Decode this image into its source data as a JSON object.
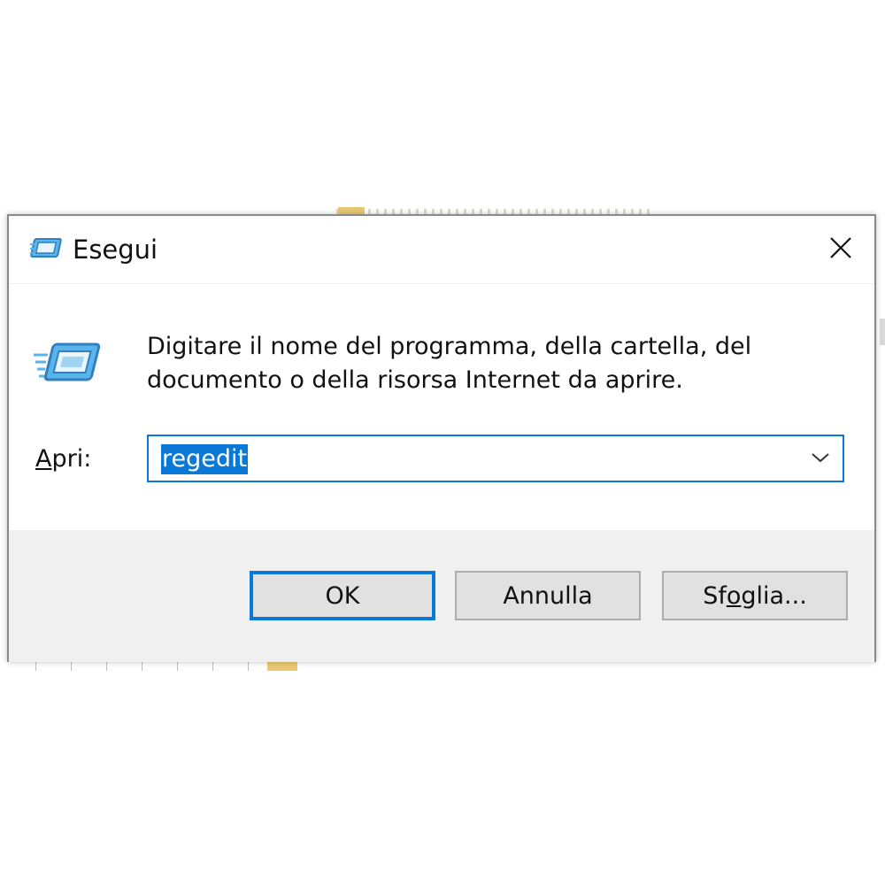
{
  "dialog": {
    "title": "Esegui",
    "title_icon": "run-icon",
    "close_icon": "close-icon",
    "description": "Digitare il nome del programma, della cartella, del documento o della risorsa Internet da aprire.",
    "open_label_accel": "A",
    "open_label_rest": "pri:",
    "open_value": "regedit",
    "dropdown_icon": "chevron-down-icon",
    "buttons": {
      "ok": "OK",
      "cancel": "Annulla",
      "browse_pre": "Sf",
      "browse_accel": "o",
      "browse_post": "glia..."
    }
  },
  "colors": {
    "accent": "#0a78d7",
    "footer_bg": "#f0f0f0",
    "button_bg": "#e1e1e1"
  }
}
